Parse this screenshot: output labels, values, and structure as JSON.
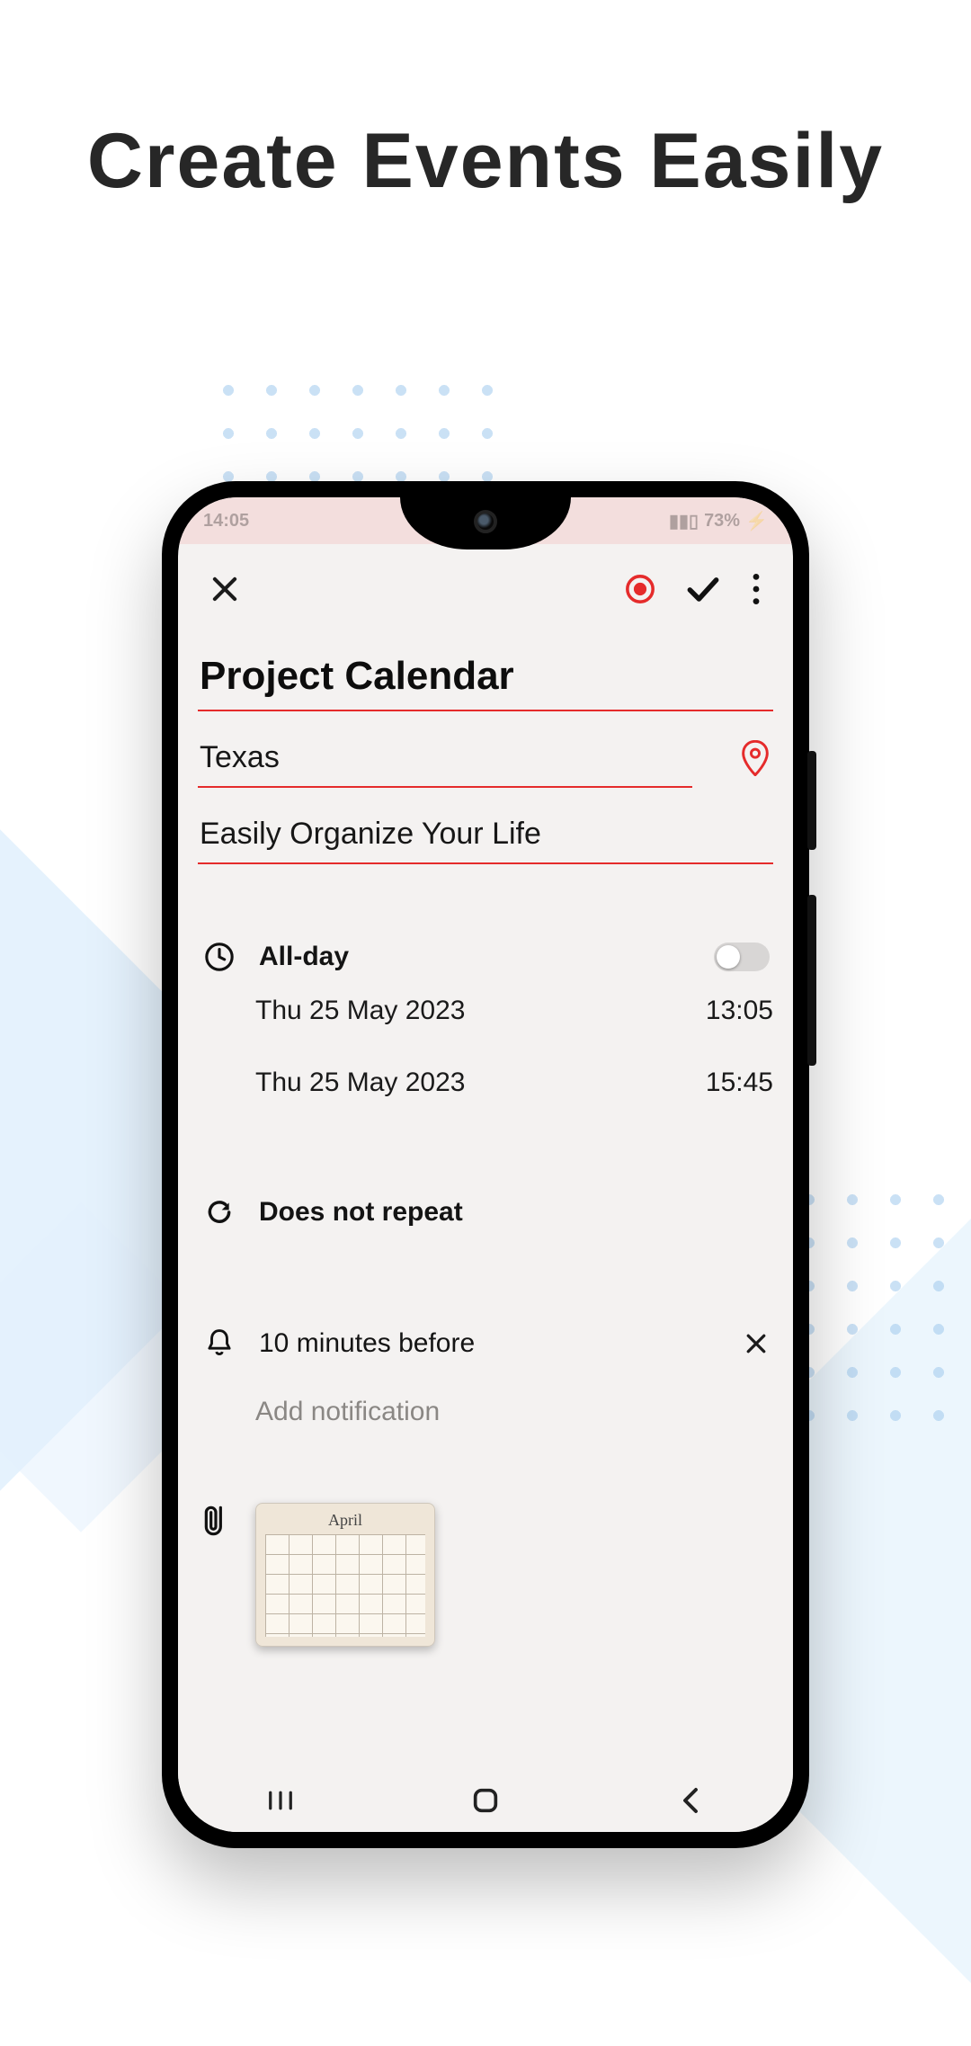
{
  "promo": {
    "headline": "Create Events Easily"
  },
  "statusbar": {
    "time": "14:05",
    "battery": "73%"
  },
  "event": {
    "title": "Project Calendar",
    "location": "Texas",
    "description": "Easily Organize Your Life",
    "all_day_label": "All-day",
    "all_day_on": false,
    "start": {
      "date": "Thu 25 May 2023",
      "time": "13:05"
    },
    "end": {
      "date": "Thu 25 May 2023",
      "time": "15:45"
    },
    "repeat_label": "Does not repeat",
    "notification_label": "10 minutes before",
    "add_notification_label": "Add notification"
  },
  "colors": {
    "accent": "#e52b2b"
  }
}
